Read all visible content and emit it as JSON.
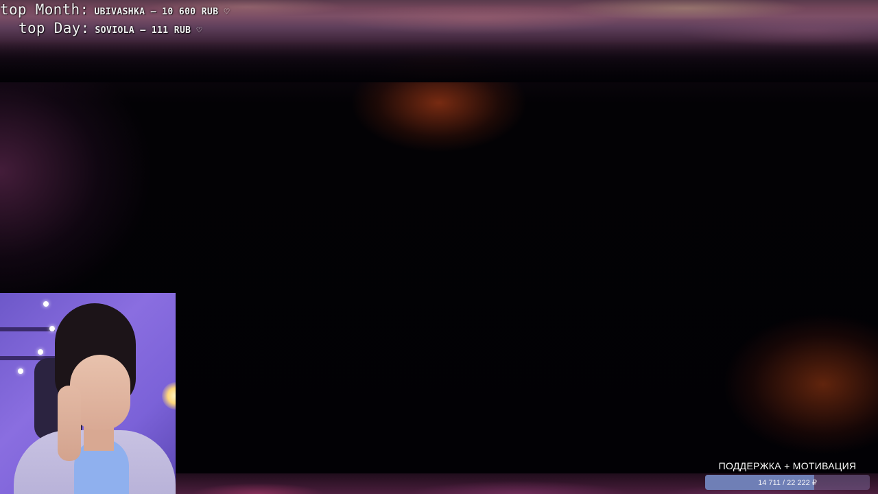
{
  "top_donors": {
    "month": {
      "label": "top Month:",
      "value": "UBIVASHKA – 10 600 RUB ♡"
    },
    "day": {
      "label": "top Day:",
      "value": "SOVIOLA – 111 RUB ♡"
    }
  },
  "support_goal": {
    "title": "ПОДДЕРЖКА + МОТИВАЦИЯ",
    "progress_text": "14 711 / 22 222 ₽",
    "current": 14711,
    "target": 22222,
    "fill_color": "#6f7fb6"
  }
}
